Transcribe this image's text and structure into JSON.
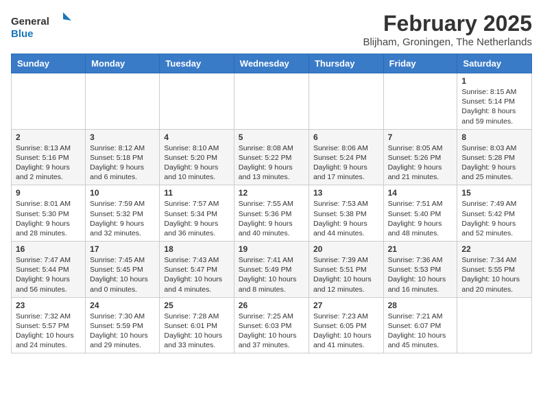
{
  "header": {
    "logo_general": "General",
    "logo_blue": "Blue",
    "title": "February 2025",
    "subtitle": "Blijham, Groningen, The Netherlands"
  },
  "weekdays": [
    "Sunday",
    "Monday",
    "Tuesday",
    "Wednesday",
    "Thursday",
    "Friday",
    "Saturday"
  ],
  "weeks": [
    [
      {
        "day": "",
        "info": ""
      },
      {
        "day": "",
        "info": ""
      },
      {
        "day": "",
        "info": ""
      },
      {
        "day": "",
        "info": ""
      },
      {
        "day": "",
        "info": ""
      },
      {
        "day": "",
        "info": ""
      },
      {
        "day": "1",
        "info": "Sunrise: 8:15 AM\nSunset: 5:14 PM\nDaylight: 8 hours and 59 minutes."
      }
    ],
    [
      {
        "day": "2",
        "info": "Sunrise: 8:13 AM\nSunset: 5:16 PM\nDaylight: 9 hours and 2 minutes."
      },
      {
        "day": "3",
        "info": "Sunrise: 8:12 AM\nSunset: 5:18 PM\nDaylight: 9 hours and 6 minutes."
      },
      {
        "day": "4",
        "info": "Sunrise: 8:10 AM\nSunset: 5:20 PM\nDaylight: 9 hours and 10 minutes."
      },
      {
        "day": "5",
        "info": "Sunrise: 8:08 AM\nSunset: 5:22 PM\nDaylight: 9 hours and 13 minutes."
      },
      {
        "day": "6",
        "info": "Sunrise: 8:06 AM\nSunset: 5:24 PM\nDaylight: 9 hours and 17 minutes."
      },
      {
        "day": "7",
        "info": "Sunrise: 8:05 AM\nSunset: 5:26 PM\nDaylight: 9 hours and 21 minutes."
      },
      {
        "day": "8",
        "info": "Sunrise: 8:03 AM\nSunset: 5:28 PM\nDaylight: 9 hours and 25 minutes."
      }
    ],
    [
      {
        "day": "9",
        "info": "Sunrise: 8:01 AM\nSunset: 5:30 PM\nDaylight: 9 hours and 28 minutes."
      },
      {
        "day": "10",
        "info": "Sunrise: 7:59 AM\nSunset: 5:32 PM\nDaylight: 9 hours and 32 minutes."
      },
      {
        "day": "11",
        "info": "Sunrise: 7:57 AM\nSunset: 5:34 PM\nDaylight: 9 hours and 36 minutes."
      },
      {
        "day": "12",
        "info": "Sunrise: 7:55 AM\nSunset: 5:36 PM\nDaylight: 9 hours and 40 minutes."
      },
      {
        "day": "13",
        "info": "Sunrise: 7:53 AM\nSunset: 5:38 PM\nDaylight: 9 hours and 44 minutes."
      },
      {
        "day": "14",
        "info": "Sunrise: 7:51 AM\nSunset: 5:40 PM\nDaylight: 9 hours and 48 minutes."
      },
      {
        "day": "15",
        "info": "Sunrise: 7:49 AM\nSunset: 5:42 PM\nDaylight: 9 hours and 52 minutes."
      }
    ],
    [
      {
        "day": "16",
        "info": "Sunrise: 7:47 AM\nSunset: 5:44 PM\nDaylight: 9 hours and 56 minutes."
      },
      {
        "day": "17",
        "info": "Sunrise: 7:45 AM\nSunset: 5:45 PM\nDaylight: 10 hours and 0 minutes."
      },
      {
        "day": "18",
        "info": "Sunrise: 7:43 AM\nSunset: 5:47 PM\nDaylight: 10 hours and 4 minutes."
      },
      {
        "day": "19",
        "info": "Sunrise: 7:41 AM\nSunset: 5:49 PM\nDaylight: 10 hours and 8 minutes."
      },
      {
        "day": "20",
        "info": "Sunrise: 7:39 AM\nSunset: 5:51 PM\nDaylight: 10 hours and 12 minutes."
      },
      {
        "day": "21",
        "info": "Sunrise: 7:36 AM\nSunset: 5:53 PM\nDaylight: 10 hours and 16 minutes."
      },
      {
        "day": "22",
        "info": "Sunrise: 7:34 AM\nSunset: 5:55 PM\nDaylight: 10 hours and 20 minutes."
      }
    ],
    [
      {
        "day": "23",
        "info": "Sunrise: 7:32 AM\nSunset: 5:57 PM\nDaylight: 10 hours and 24 minutes."
      },
      {
        "day": "24",
        "info": "Sunrise: 7:30 AM\nSunset: 5:59 PM\nDaylight: 10 hours and 29 minutes."
      },
      {
        "day": "25",
        "info": "Sunrise: 7:28 AM\nSunset: 6:01 PM\nDaylight: 10 hours and 33 minutes."
      },
      {
        "day": "26",
        "info": "Sunrise: 7:25 AM\nSunset: 6:03 PM\nDaylight: 10 hours and 37 minutes."
      },
      {
        "day": "27",
        "info": "Sunrise: 7:23 AM\nSunset: 6:05 PM\nDaylight: 10 hours and 41 minutes."
      },
      {
        "day": "28",
        "info": "Sunrise: 7:21 AM\nSunset: 6:07 PM\nDaylight: 10 hours and 45 minutes."
      },
      {
        "day": "",
        "info": ""
      }
    ]
  ]
}
